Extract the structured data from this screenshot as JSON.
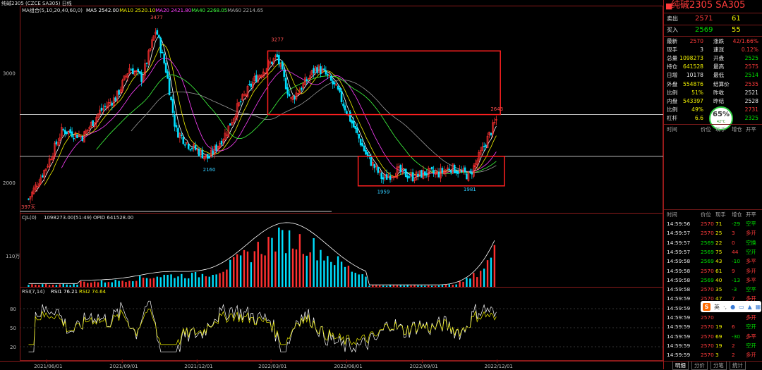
{
  "window_title": "纯碱2305 (CZCE SA305)  日线",
  "title_ma": "MA组合(5,10,20,40,60,0)",
  "ma_legend": [
    {
      "label": "MA5 2542.00",
      "color": "#ffffff"
    },
    {
      "label": "MA10 2520.10",
      "color": "#f0f000"
    },
    {
      "label": "MA20 2421.80",
      "color": "#ff40ff"
    },
    {
      "label": "MA40 2268.05",
      "color": "#40ff40"
    },
    {
      "label": "MA60 2214.65",
      "color": "#aaaaaa"
    }
  ],
  "volume_legend": {
    "label": "CJL(0)",
    "value": "1098273.00(51:49)",
    "opid": "OPID 641528.00"
  },
  "rsi_legend": {
    "label": "RSI(7,14)",
    "rsi1": "RSI1 76.21",
    "rsi2": "RSI2 74.64"
  },
  "chart_data": [
    {
      "type": "candlestick",
      "title": "纯碱2305 (CZCE SA305) 日线",
      "y_ticks": [
        2000,
        3000
      ],
      "ylim": [
        1750,
        3600
      ],
      "x_ticks": [
        "2021/06/01",
        "2021/09/01",
        "2021/12/01",
        "2022/03/01",
        "2022/06/01",
        "2022/09/01",
        "2022/12/01"
      ],
      "annotations": [
        {
          "label": "3477",
          "value": 3477,
          "date": "2021/10/12"
        },
        {
          "label": "2160",
          "value": 2160,
          "date": "2021/12/15"
        },
        {
          "label": "3277",
          "value": 3277,
          "date": "2022/03/08"
        },
        {
          "label": "1959",
          "value": 1959,
          "date": "2022/07/15"
        },
        {
          "label": "1981",
          "value": 1981,
          "date": "2022/10/28"
        },
        {
          "label": "2643",
          "value": 2643,
          "date": "2022/11/30"
        },
        {
          "label": "397天",
          "value": null,
          "date": ""
        }
      ],
      "price_path": [
        [
          "2021/05/10",
          1850
        ],
        [
          "2021/06/01",
          2150
        ],
        [
          "2021/06/20",
          2480
        ],
        [
          "2021/07/15",
          2420
        ],
        [
          "2021/08/05",
          2650
        ],
        [
          "2021/08/25",
          2780
        ],
        [
          "2021/09/10",
          3050
        ],
        [
          "2021/09/25",
          2950
        ],
        [
          "2021/10/12",
          3400
        ],
        [
          "2021/10/25",
          3000
        ],
        [
          "2021/11/05",
          2480
        ],
        [
          "2021/11/20",
          2350
        ],
        [
          "2021/12/15",
          2220
        ],
        [
          "2022/01/05",
          2450
        ],
        [
          "2022/01/20",
          2700
        ],
        [
          "2022/02/10",
          2950
        ],
        [
          "2022/03/08",
          3150
        ],
        [
          "2022/03/25",
          2750
        ],
        [
          "2022/04/10",
          2900
        ],
        [
          "2022/04/25",
          3050
        ],
        [
          "2022/05/05",
          3000
        ],
        [
          "2022/05/20",
          2850
        ],
        [
          "2022/06/10",
          2500
        ],
        [
          "2022/06/25",
          2250
        ],
        [
          "2022/07/15",
          2030
        ],
        [
          "2022/08/01",
          2110
        ],
        [
          "2022/08/20",
          2050
        ],
        [
          "2022/09/05",
          2090
        ],
        [
          "2022/09/20",
          2080
        ],
        [
          "2022/10/05",
          2140
        ],
        [
          "2022/10/28",
          2060
        ],
        [
          "2022/11/10",
          2250
        ],
        [
          "2022/11/30",
          2571
        ]
      ],
      "boxes": [
        {
          "from": "2022/02/25",
          "to": "2022/12/05",
          "top": 3200,
          "bottom": 2620
        },
        {
          "from": "2022/06/15",
          "to": "2022/12/10",
          "top": 2240,
          "bottom": 1970
        }
      ],
      "hlines": [
        2620,
        2240
      ]
    },
    {
      "type": "bar",
      "title": "CJL(0)",
      "ylabel": "",
      "y_ticks": [
        "110万"
      ]
    },
    {
      "type": "line",
      "title": "RSI(7,14)",
      "y_ticks": [
        20,
        50,
        80
      ],
      "ylim": [
        0,
        100
      ]
    }
  ],
  "panel": {
    "code": "纯碱2305 SA305",
    "ask": {
      "label": "卖出",
      "price": "2571",
      "qty": "61"
    },
    "bid": {
      "label": "买入",
      "price": "2569",
      "qty": "55"
    },
    "quote_rows": [
      {
        "l1": "最新",
        "v1": "2570",
        "c1": "red",
        "l2": "涨跌",
        "v2": "42/1.66%",
        "c2": "red"
      },
      {
        "l1": "现手",
        "v1": "3",
        "c1": "white",
        "l2": "速涨",
        "v2": "0.12%",
        "c2": "red"
      },
      {
        "l1": "总量",
        "v1": "1098273",
        "c1": "yellow",
        "l2": "开盘",
        "v2": "2525",
        "c2": "green"
      },
      {
        "l1": "持仓",
        "v1": "641528",
        "c1": "yellow",
        "l2": "最高",
        "v2": "2575",
        "c2": "red"
      },
      {
        "l1": "日增",
        "v1": "10178",
        "c1": "white",
        "l2": "最低",
        "v2": "2514",
        "c2": "green"
      },
      {
        "l1": "外盘",
        "v1": "554876",
        "c1": "yellow",
        "l2": "结算价",
        "v2": "2535",
        "c2": "red"
      },
      {
        "l1": "比例",
        "v1": "51%",
        "c1": "yellow",
        "l2": "昨收",
        "v2": "2521",
        "c2": "white"
      },
      {
        "l1": "内盘",
        "v1": "543397",
        "c1": "yellow",
        "l2": "昨结",
        "v2": "2528",
        "c2": "white"
      },
      {
        "l1": "比例",
        "v1": "49%",
        "c1": "yellow",
        "l2": "",
        "v2": "2731",
        "c2": "red"
      },
      {
        "l1": "杠杆",
        "v1": "6.6",
        "c1": "yellow",
        "l2": "",
        "v2": "2325",
        "c2": "green"
      }
    ],
    "cpu_gauge": {
      "percent": "65%",
      "temp": "42°C"
    },
    "mini_headers": [
      "时间",
      "价位",
      "现手",
      "增仓",
      "开平"
    ],
    "tick_headers": [
      "时间",
      "价位",
      "现手",
      "增仓",
      "开平"
    ],
    "ticks": [
      [
        "14:59:56",
        "2570",
        "71",
        "-29",
        "空平"
      ],
      [
        "14:59:57",
        "2570",
        "25",
        "3",
        "多开"
      ],
      [
        "14:59:57",
        "2569",
        "22",
        "0",
        "空换"
      ],
      [
        "14:59:57",
        "2569",
        "75",
        "44",
        "空开"
      ],
      [
        "14:59:58",
        "2569",
        "43",
        "-10",
        "多平"
      ],
      [
        "14:59:58",
        "2570",
        "61",
        "9",
        "多开"
      ],
      [
        "14:59:58",
        "2569",
        "40",
        "-13",
        "多平"
      ],
      [
        "14:59:58",
        "2570",
        "35",
        "-3",
        "空平"
      ],
      [
        "14:59:59",
        "2570",
        "47",
        "7",
        "多开"
      ],
      [
        "14:59:59",
        "2570",
        "",
        "",
        "多开"
      ],
      [
        "14:59:59",
        "2570",
        "",
        "",
        "多开"
      ],
      [
        "14:59:59",
        "2570",
        "19",
        "6",
        "空开"
      ],
      [
        "14:59:59",
        "2570",
        "69",
        "-30",
        "多平"
      ],
      [
        "14:59:59",
        "2570",
        "19",
        "2",
        "空开"
      ],
      [
        "14:59:59",
        "2570",
        "3",
        "2",
        "多开"
      ]
    ],
    "bottom_tabs": [
      "明细",
      "分价",
      "分笔",
      "统计"
    ]
  },
  "ime_bar": {
    "logo": "S",
    "label": "英"
  }
}
